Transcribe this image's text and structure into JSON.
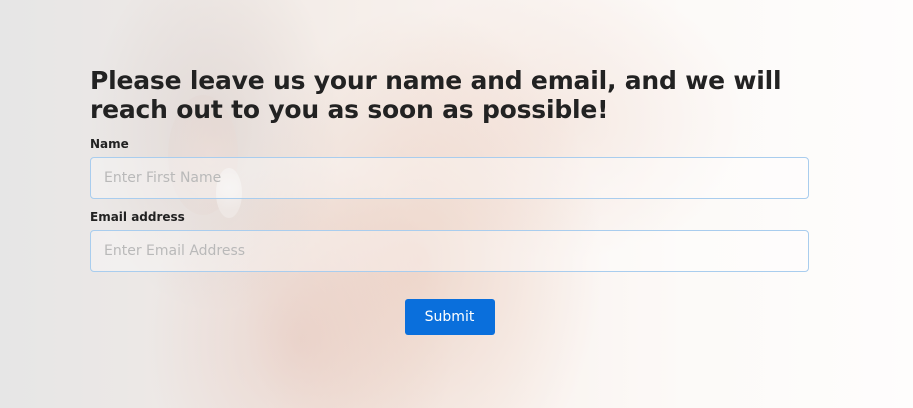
{
  "form": {
    "headline": "Please leave us your name and email, and we will reach out to you as soon as possible!",
    "name_label": "Name",
    "name_placeholder": "Enter First Name",
    "name_value": "",
    "email_label": "Email address",
    "email_placeholder": "Enter Email Address",
    "email_value": "",
    "submit_label": "Submit"
  },
  "colors": {
    "accent": "#0a6fdc",
    "input_border": "#a9cdee",
    "text": "#222222"
  }
}
